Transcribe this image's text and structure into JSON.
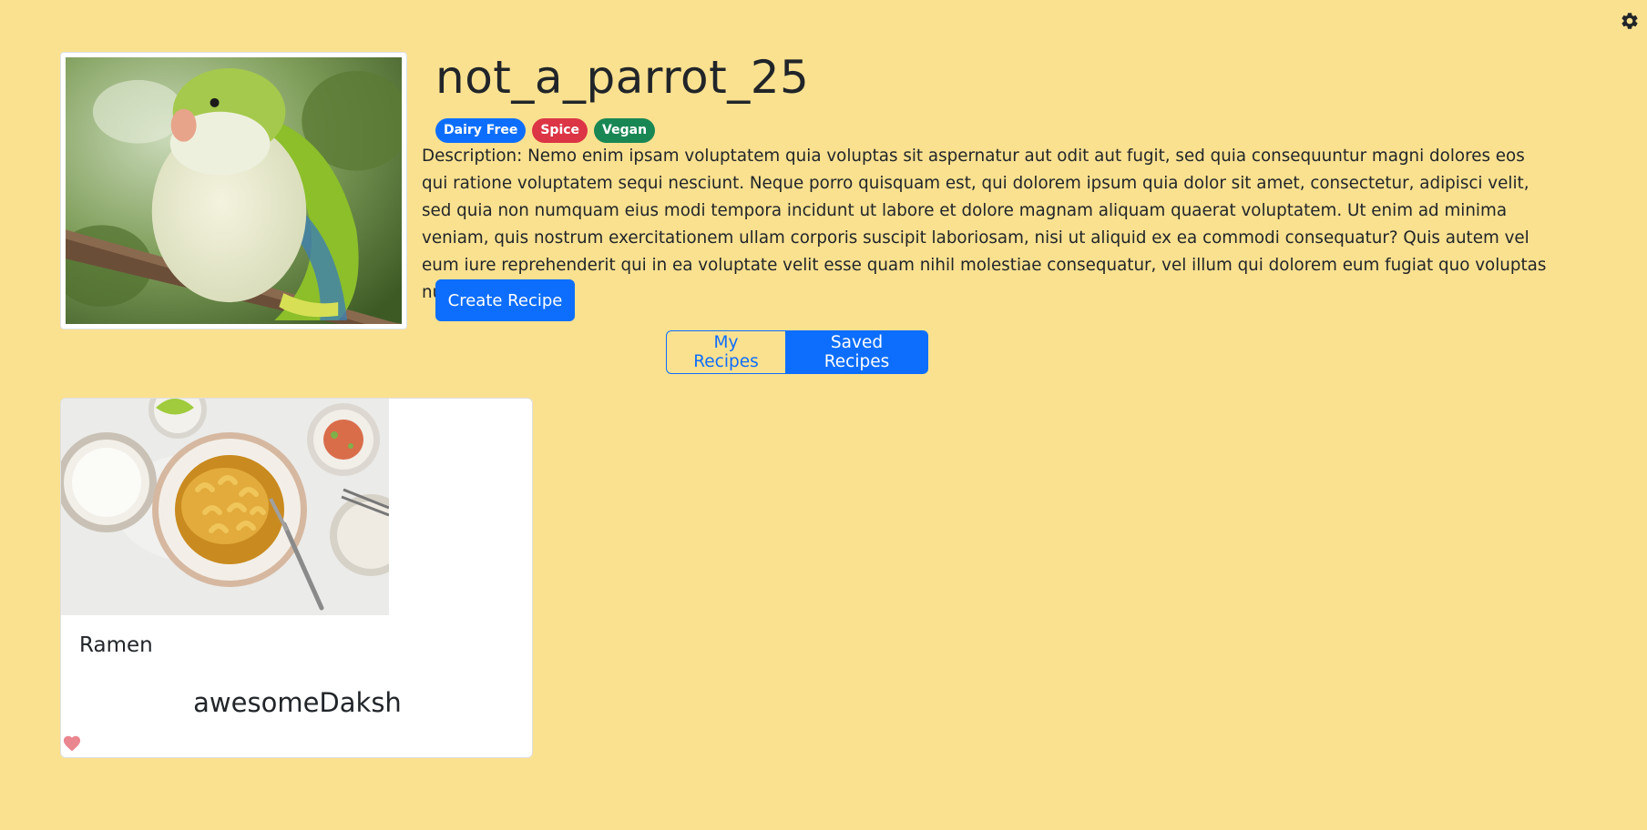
{
  "header": {
    "settings_icon": "gear-icon"
  },
  "profile": {
    "username": "not_a_parrot_25",
    "avatar_icon": "parrot-photo",
    "tags": [
      {
        "label": "Dairy Free",
        "color": "#0d6efd"
      },
      {
        "label": "Spice",
        "color": "#dc3545"
      },
      {
        "label": "Vegan",
        "color": "#198754"
      }
    ],
    "description": "Description: Nemo enim ipsam voluptatem quia voluptas sit aspernatur aut odit aut fugit, sed quia consequuntur magni dolores eos qui ratione voluptatem sequi nesciunt. Neque porro quisquam est, qui dolorem ipsum quia dolor sit amet, consectetur, adipisci velit, sed quia non numquam eius modi tempora incidunt ut labore et dolore magnam aliquam quaerat voluptatem. Ut enim ad minima veniam, quis nostrum exercitationem ullam corporis suscipit laboriosam, nisi ut aliquid ex ea commodi consequatur? Quis autem vel eum iure reprehenderit qui in ea voluptate velit esse quam nihil molestiae consequatur, vel illum qui dolorem eum fugiat quo voluptas nulla pariatur?",
    "create_button_label": "Create Recipe"
  },
  "recipe_tabs": {
    "tabs": [
      {
        "label": "My Recipes",
        "active": false
      },
      {
        "label": "Saved Recipes",
        "active": true
      }
    ]
  },
  "recipes": [
    {
      "title": "Ramen",
      "author": "awesomeDaksh",
      "image_icon": "food-bowl-photo",
      "liked": true
    }
  ],
  "colors": {
    "background": "#fae190",
    "primary": "#0d6efd",
    "heart": "#ea868f"
  }
}
